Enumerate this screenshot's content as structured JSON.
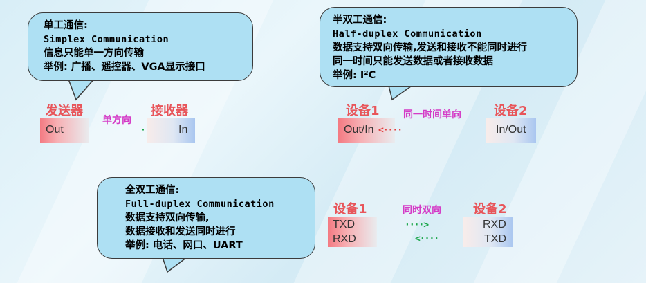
{
  "simplex": {
    "title": "单工通信:",
    "english": "Simplex Communication",
    "desc": "信息只能单一方向传输",
    "example": "举例: 广播、遥控器、VGA显示接口",
    "sender_label": "发送器",
    "receiver_label": "接收器",
    "direction_label": "单方向",
    "sender_port": "Out",
    "receiver_port": "In",
    "arrow": "····>"
  },
  "half_duplex": {
    "title": "半双工通信:",
    "english": "Half-duplex Communication",
    "desc1": "数据支持双向传输,发送和接收不能同时进行",
    "desc2": "同一时间只能发送数据或者接收数据",
    "example": "举例: I²C",
    "device1_label": "设备1",
    "device2_label": "设备2",
    "direction_label": "同一时间单向",
    "device1_port": "Out/In",
    "device2_port": "In/Out",
    "arrow": "<····"
  },
  "full_duplex": {
    "title": "全双工通信:",
    "english": "Full-duplex Communication",
    "desc1": "数据支持双向传输,",
    "desc2": "数据接收和发送同时进行",
    "example": "举例: 电话、网口、UART",
    "device1_label": "设备1",
    "device2_label": "设备2",
    "direction_label": "同时双向",
    "device1_tx": "TXD",
    "device1_rx": "RXD",
    "device2_rx": "RXD",
    "device2_tx": "TXD",
    "arrow_right": "····>",
    "arrow_left": "<····"
  },
  "colors": {
    "bubble_fill": "#aee0f3",
    "label_red": "#e8555a",
    "label_magenta": "#d43bc6",
    "arrow_green": "#1aa64a",
    "arrow_red": "#e23b3b"
  }
}
